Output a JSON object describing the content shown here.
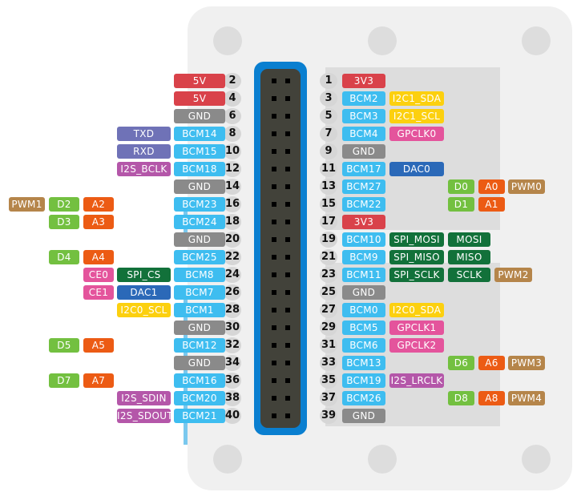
{
  "colors": {
    "power5v": "#d9424a",
    "power3v3": "#d9424a",
    "gnd": "#8a8a8a",
    "bcm": "#3ebdf0",
    "uart": "#6f72b7",
    "i2s": "#b457a9",
    "i2c": "#fcd00f",
    "gpclk": "#e4549c",
    "dac": "#2b69b8",
    "spi": "#12713a",
    "digital": "#73c040",
    "analog": "#ec5b14",
    "pwm": "#b5854a",
    "ce": "#e4549c"
  },
  "left_pins": [
    {
      "pin": "2",
      "labels": [
        {
          "text": "5V",
          "type": "power5v"
        }
      ]
    },
    {
      "pin": "4",
      "labels": [
        {
          "text": "5V",
          "type": "power5v"
        }
      ]
    },
    {
      "pin": "6",
      "labels": [
        {
          "text": "GND",
          "type": "gnd"
        }
      ]
    },
    {
      "pin": "8",
      "labels": [
        {
          "text": "BCM14",
          "type": "bcm"
        },
        {
          "text": "TXD",
          "type": "uart"
        }
      ]
    },
    {
      "pin": "10",
      "labels": [
        {
          "text": "BCM15",
          "type": "bcm"
        },
        {
          "text": "RXD",
          "type": "uart"
        }
      ]
    },
    {
      "pin": "12",
      "labels": [
        {
          "text": "BCM18",
          "type": "bcm"
        },
        {
          "text": "I2S_BCLK",
          "type": "i2s"
        }
      ]
    },
    {
      "pin": "14",
      "labels": [
        {
          "text": "GND",
          "type": "gnd"
        }
      ]
    },
    {
      "pin": "16",
      "labels": [
        {
          "text": "BCM23",
          "type": "bcm"
        }
      ],
      "extra": [
        {
          "text": "A2",
          "type": "analog"
        },
        {
          "text": "D2",
          "type": "digital"
        },
        {
          "text": "PWM1",
          "type": "pwm"
        }
      ]
    },
    {
      "pin": "18",
      "labels": [
        {
          "text": "BCM24",
          "type": "bcm"
        }
      ],
      "extra": [
        {
          "text": "A3",
          "type": "analog"
        },
        {
          "text": "D3",
          "type": "digital"
        }
      ]
    },
    {
      "pin": "20",
      "labels": [
        {
          "text": "GND",
          "type": "gnd"
        }
      ]
    },
    {
      "pin": "22",
      "labels": [
        {
          "text": "BCM25",
          "type": "bcm"
        }
      ],
      "extra": [
        {
          "text": "A4",
          "type": "analog"
        },
        {
          "text": "D4",
          "type": "digital"
        }
      ]
    },
    {
      "pin": "24",
      "labels": [
        {
          "text": "BCM8",
          "type": "bcm"
        },
        {
          "text": "SPI_CS",
          "type": "spi"
        },
        {
          "text": "CE0",
          "type": "ce"
        }
      ]
    },
    {
      "pin": "26",
      "labels": [
        {
          "text": "BCM7",
          "type": "bcm"
        },
        {
          "text": "DAC1",
          "type": "dac"
        },
        {
          "text": "CE1",
          "type": "ce"
        }
      ]
    },
    {
      "pin": "28",
      "labels": [
        {
          "text": "BCM1",
          "type": "bcm"
        },
        {
          "text": "I2C0_SCL",
          "type": "i2c"
        }
      ]
    },
    {
      "pin": "30",
      "labels": [
        {
          "text": "GND",
          "type": "gnd"
        }
      ]
    },
    {
      "pin": "32",
      "labels": [
        {
          "text": "BCM12",
          "type": "bcm"
        }
      ],
      "extra": [
        {
          "text": "A5",
          "type": "analog"
        },
        {
          "text": "D5",
          "type": "digital"
        }
      ]
    },
    {
      "pin": "34",
      "labels": [
        {
          "text": "GND",
          "type": "gnd"
        }
      ]
    },
    {
      "pin": "36",
      "labels": [
        {
          "text": "BCM16",
          "type": "bcm"
        }
      ],
      "extra": [
        {
          "text": "A7",
          "type": "analog"
        },
        {
          "text": "D7",
          "type": "digital"
        }
      ]
    },
    {
      "pin": "38",
      "labels": [
        {
          "text": "BCM20",
          "type": "bcm"
        },
        {
          "text": "I2S_SDIN",
          "type": "i2s"
        }
      ]
    },
    {
      "pin": "40",
      "labels": [
        {
          "text": "BCM21",
          "type": "bcm"
        },
        {
          "text": "I2S_SDOUT",
          "type": "i2s"
        }
      ]
    }
  ],
  "right_pins": [
    {
      "pin": "1",
      "labels": [
        {
          "text": "3V3",
          "type": "power3v3"
        }
      ]
    },
    {
      "pin": "3",
      "labels": [
        {
          "text": "BCM2",
          "type": "bcm"
        },
        {
          "text": "I2C1_SDA",
          "type": "i2c"
        }
      ]
    },
    {
      "pin": "5",
      "labels": [
        {
          "text": "BCM3",
          "type": "bcm"
        },
        {
          "text": "I2C1_SCL",
          "type": "i2c"
        }
      ]
    },
    {
      "pin": "7",
      "labels": [
        {
          "text": "BCM4",
          "type": "bcm"
        },
        {
          "text": "GPCLK0",
          "type": "gpclk"
        }
      ]
    },
    {
      "pin": "9",
      "labels": [
        {
          "text": "GND",
          "type": "gnd"
        }
      ]
    },
    {
      "pin": "11",
      "labels": [
        {
          "text": "BCM17",
          "type": "bcm"
        },
        {
          "text": "DAC0",
          "type": "dac"
        }
      ]
    },
    {
      "pin": "13",
      "labels": [
        {
          "text": "BCM27",
          "type": "bcm"
        }
      ],
      "extra": [
        {
          "text": "D0",
          "type": "digital"
        },
        {
          "text": "A0",
          "type": "analog"
        },
        {
          "text": "PWM0",
          "type": "pwm"
        }
      ]
    },
    {
      "pin": "15",
      "labels": [
        {
          "text": "BCM22",
          "type": "bcm"
        }
      ],
      "extra": [
        {
          "text": "D1",
          "type": "digital"
        },
        {
          "text": "A1",
          "type": "analog"
        }
      ]
    },
    {
      "pin": "17",
      "labels": [
        {
          "text": "3V3",
          "type": "power3v3"
        }
      ]
    },
    {
      "pin": "19",
      "labels": [
        {
          "text": "BCM10",
          "type": "bcm"
        },
        {
          "text": "SPI_MOSI",
          "type": "spi"
        },
        {
          "text": "MOSI",
          "type": "spi"
        }
      ]
    },
    {
      "pin": "21",
      "labels": [
        {
          "text": "BCM9",
          "type": "bcm"
        },
        {
          "text": "SPI_MISO",
          "type": "spi"
        },
        {
          "text": "MISO",
          "type": "spi"
        }
      ]
    },
    {
      "pin": "23",
      "labels": [
        {
          "text": "BCM11",
          "type": "bcm"
        },
        {
          "text": "SPI_SCLK",
          "type": "spi"
        },
        {
          "text": "SCLK",
          "type": "spi"
        },
        {
          "text": "PWM2",
          "type": "pwm"
        }
      ]
    },
    {
      "pin": "25",
      "labels": [
        {
          "text": "GND",
          "type": "gnd"
        }
      ]
    },
    {
      "pin": "27",
      "labels": [
        {
          "text": "BCM0",
          "type": "bcm"
        },
        {
          "text": "I2C0_SDA",
          "type": "i2c"
        }
      ]
    },
    {
      "pin": "29",
      "labels": [
        {
          "text": "BCM5",
          "type": "bcm"
        },
        {
          "text": "GPCLK1",
          "type": "gpclk"
        }
      ]
    },
    {
      "pin": "31",
      "labels": [
        {
          "text": "BCM6",
          "type": "bcm"
        },
        {
          "text": "GPCLK2",
          "type": "gpclk"
        }
      ]
    },
    {
      "pin": "33",
      "labels": [
        {
          "text": "BCM13",
          "type": "bcm"
        }
      ],
      "extra": [
        {
          "text": "D6",
          "type": "digital"
        },
        {
          "text": "A6",
          "type": "analog"
        },
        {
          "text": "PWM3",
          "type": "pwm"
        }
      ]
    },
    {
      "pin": "35",
      "labels": [
        {
          "text": "BCM19",
          "type": "bcm"
        },
        {
          "text": "I2S_LRCLK",
          "type": "i2s"
        }
      ]
    },
    {
      "pin": "37",
      "labels": [
        {
          "text": "BCM26",
          "type": "bcm"
        }
      ],
      "extra": [
        {
          "text": "D8",
          "type": "digital"
        },
        {
          "text": "A8",
          "type": "analog"
        },
        {
          "text": "PWM4",
          "type": "pwm"
        }
      ]
    },
    {
      "pin": "39",
      "labels": [
        {
          "text": "GND",
          "type": "gnd"
        }
      ]
    }
  ]
}
